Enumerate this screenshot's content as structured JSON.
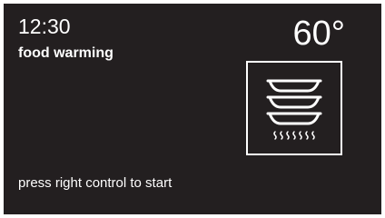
{
  "status": {
    "time": "12:30",
    "mode_label": "food warming",
    "temperature": "60°"
  },
  "mode_icon": "food-warming-icon",
  "hint": "press right control to start",
  "colors": {
    "screen_background": "#231f20",
    "text": "#ffffff"
  }
}
